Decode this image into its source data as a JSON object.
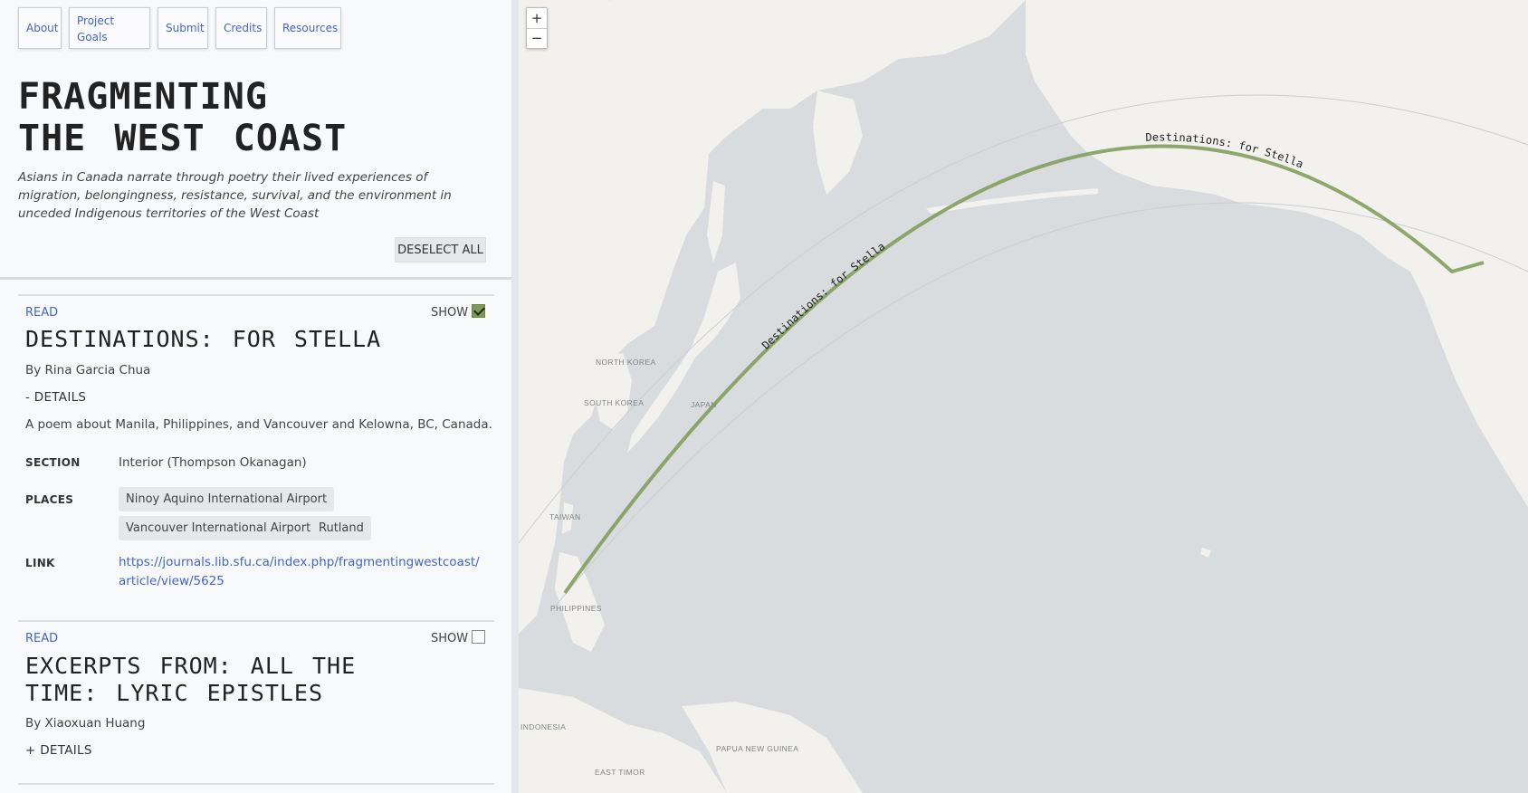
{
  "nav": [
    "About",
    "Project Goals",
    "Submit",
    "Credits",
    "Resources"
  ],
  "header": {
    "title_line1": "FRAGMENTING",
    "title_line2": "THE WEST COAST",
    "subtitle": "Asians in Canada narrate through poetry their lived experiences of migration, belongingness, resistance, survival, and the environment in unceded Indigenous territories of the West Coast",
    "deselect_label": "DESELECT ALL"
  },
  "poems": [
    {
      "read_label": "READ",
      "show_label": "SHOW",
      "checked": true,
      "title": "DESTINATIONS: FOR STELLA",
      "byline": "By Rina Garcia Chua",
      "details_toggle": "- DETAILS",
      "description": "A poem about Manila, Philippines, and Vancouver and Kelowna, BC, Canada.",
      "section_label": "SECTION",
      "section_value": "Interior (Thompson Okanagan)",
      "places_label": "PLACES",
      "places": [
        "Ninoy Aquino International Airport",
        "Vancouver International Airport",
        "Rutland"
      ],
      "link_label": "LINK",
      "link_value": "https://journals.lib.sfu.ca/index.php/fragmentingwestcoast/article/view/5625"
    },
    {
      "read_label": "READ",
      "show_label": "SHOW",
      "checked": false,
      "title_line1": "EXCERPTS FROM: ALL THE",
      "title_line2": "TIME: LYRIC EPISTLES",
      "byline": "By Xiaoxuan Huang",
      "details_toggle": "+ DETAILS"
    }
  ],
  "map": {
    "zoom_in": "+",
    "zoom_out": "−",
    "route_label": "Destinations: for Stella",
    "labels": [
      "NORTH KOREA",
      "SOUTH KOREA",
      "JAPAN",
      "TAIWAN",
      "PHILIPPINES",
      "INDONESIA",
      "PAPUA NEW GUINEA",
      "EAST TIMOR"
    ],
    "route_color": "#7d9a55",
    "land_color": "#f2f1ee",
    "water_color": "#d8dcde"
  }
}
